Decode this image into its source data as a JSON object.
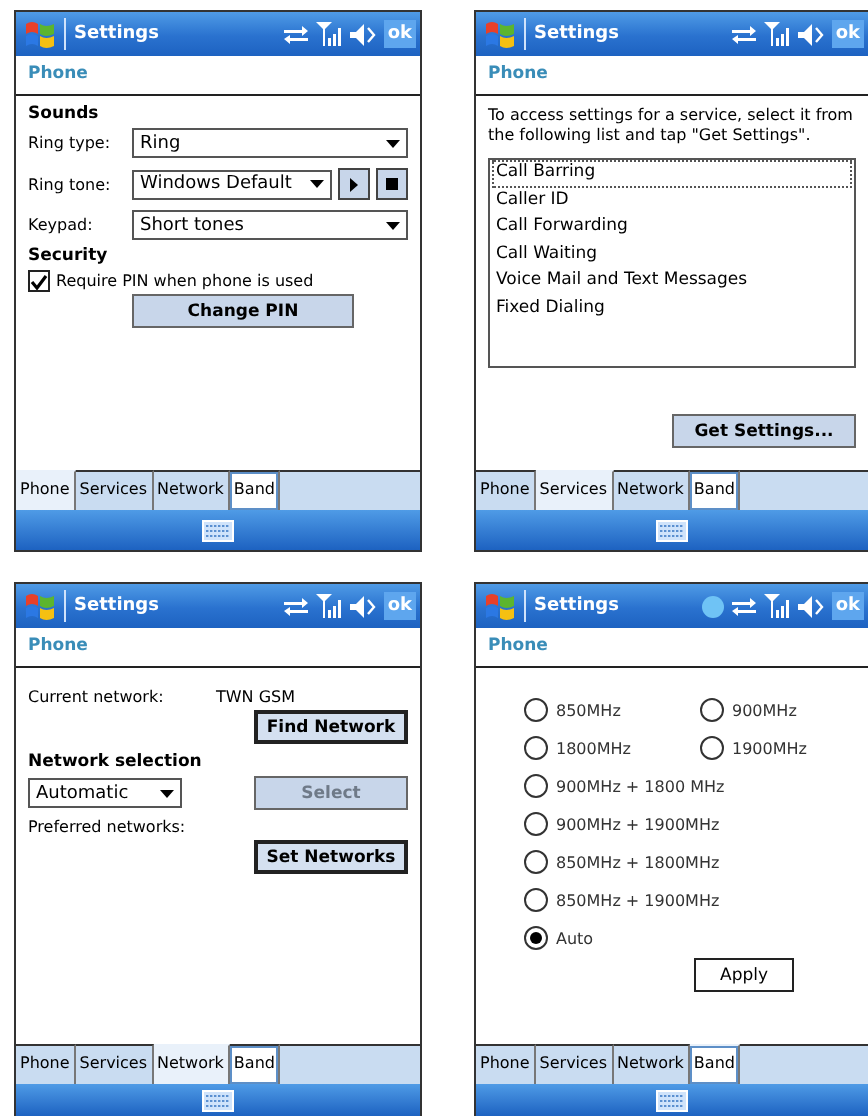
{
  "screens": [
    {
      "title": "Settings",
      "ok": "ok",
      "busy": false,
      "header": "Phone",
      "kind": "phone",
      "sounds_heading": "Sounds",
      "fields": [
        {
          "label": "Ring type:",
          "value": "Ring",
          "media_controls": false
        },
        {
          "label": "Ring tone:",
          "value": "Windows Default",
          "media_controls": true
        },
        {
          "label": "Keypad:",
          "value": "Short tones",
          "media_controls": false
        }
      ],
      "security_heading": "Security",
      "pin_check": {
        "label": "Require PIN when phone is used",
        "checked": true
      },
      "button": {
        "label": "Change PIN",
        "disabled": false
      },
      "tabs": [
        {
          "label": "Phone",
          "selected": true,
          "outlined": false
        },
        {
          "label": "Services",
          "selected": false,
          "outlined": false
        },
        {
          "label": "Network",
          "selected": false,
          "outlined": false
        },
        {
          "label": "Band",
          "selected": false,
          "outlined": true
        }
      ]
    },
    {
      "title": "Settings",
      "ok": "ok",
      "busy": false,
      "header": "Phone",
      "kind": "services",
      "intro": "To access settings for a service, select it from the following list and tap \"Get Settings\".",
      "services": [
        {
          "label": "Call Barring",
          "selected": true
        },
        {
          "label": "Caller ID",
          "selected": false
        },
        {
          "label": "Call Forwarding",
          "selected": false
        },
        {
          "label": "Call Waiting",
          "selected": false
        },
        {
          "label": "Voice Mail and Text Messages",
          "selected": false
        },
        {
          "label": "Fixed Dialing",
          "selected": false
        }
      ],
      "button": {
        "label": "Get Settings...",
        "disabled": false
      },
      "tabs": [
        {
          "label": "Phone",
          "selected": false,
          "outlined": false
        },
        {
          "label": "Services",
          "selected": true,
          "outlined": false
        },
        {
          "label": "Network",
          "selected": false,
          "outlined": false
        },
        {
          "label": "Band",
          "selected": false,
          "outlined": true
        }
      ]
    },
    {
      "title": "Settings",
      "ok": "ok",
      "busy": false,
      "header": "Phone",
      "kind": "network",
      "current_label": "Current network:",
      "current_value": "TWN GSM",
      "find_button": {
        "label": "Find Network",
        "disabled": false
      },
      "selection_heading": "Network selection",
      "selection": "Automatic",
      "select_button": {
        "label": "Select",
        "disabled": true
      },
      "preferred_label": "Preferred networks:",
      "set_button": {
        "label": "Set Networks",
        "disabled": false
      },
      "tabs": [
        {
          "label": "Phone",
          "selected": false,
          "outlined": false
        },
        {
          "label": "Services",
          "selected": false,
          "outlined": false
        },
        {
          "label": "Network",
          "selected": true,
          "outlined": false
        },
        {
          "label": "Band",
          "selected": false,
          "outlined": true
        }
      ]
    },
    {
      "title": "Settings",
      "ok": "ok",
      "busy": true,
      "header": "Phone",
      "kind": "band",
      "band_rows": [
        [
          {
            "label": "850MHz",
            "selected": false
          },
          {
            "label": "900MHz",
            "selected": false
          }
        ],
        [
          {
            "label": "1800MHz",
            "selected": false
          },
          {
            "label": "1900MHz",
            "selected": false
          }
        ],
        [
          {
            "label": "900MHz + 1800 MHz",
            "selected": false
          }
        ],
        [
          {
            "label": "900MHz + 1900MHz",
            "selected": false
          }
        ],
        [
          {
            "label": "850MHz + 1800MHz",
            "selected": false
          }
        ],
        [
          {
            "label": "850MHz + 1900MHz",
            "selected": false
          }
        ],
        [
          {
            "label": "Auto",
            "selected": true
          }
        ]
      ],
      "button": {
        "label": "Apply",
        "disabled": false
      },
      "tabs": [
        {
          "label": "Phone",
          "selected": false,
          "outlined": false
        },
        {
          "label": "Services",
          "selected": false,
          "outlined": false
        },
        {
          "label": "Network",
          "selected": false,
          "outlined": false
        },
        {
          "label": "Band",
          "selected": true,
          "outlined": true
        }
      ]
    }
  ]
}
